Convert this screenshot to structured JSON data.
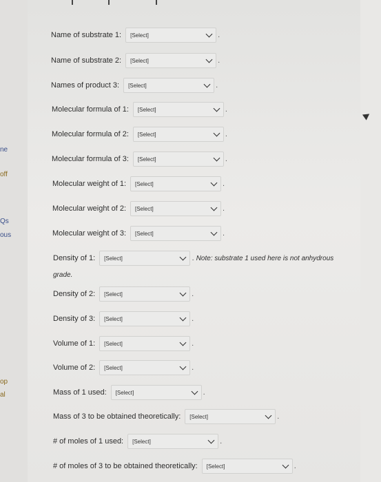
{
  "placeholder": "[Select]",
  "left_edge": {
    "a": "ne",
    "b": "off",
    "c": "Qs",
    "d": "ous",
    "e": "op",
    "f": "al"
  },
  "fields": [
    {
      "label": "Name of substrate 1:"
    },
    {
      "label": "Name of substrate 2:"
    },
    {
      "label": "Names of product 3:"
    },
    {
      "label": "Molecular formula of 1:"
    },
    {
      "label": "Molecular formula of 2:"
    },
    {
      "label": "Molecular formula of 3:"
    },
    {
      "label": "Molecular weight of 1:"
    },
    {
      "label": "Molecular weight of 2:"
    },
    {
      "label": "Molecular weight of 3:"
    },
    {
      "label": "Density of 1:",
      "note": ". Note: substrate 1 used here is not anhydrous",
      "note2": "grade."
    },
    {
      "label": "Density of 2:"
    },
    {
      "label": "Density of 3:"
    },
    {
      "label": "Volume of 1:"
    },
    {
      "label": "Volume of 2:"
    },
    {
      "label": "Mass of 1 used:"
    },
    {
      "label": "Mass of 3 to be obtained theoretically:"
    },
    {
      "label": "# of moles of 1 used:"
    },
    {
      "label": "# of moles of 3 to be obtained theoretically:"
    }
  ]
}
